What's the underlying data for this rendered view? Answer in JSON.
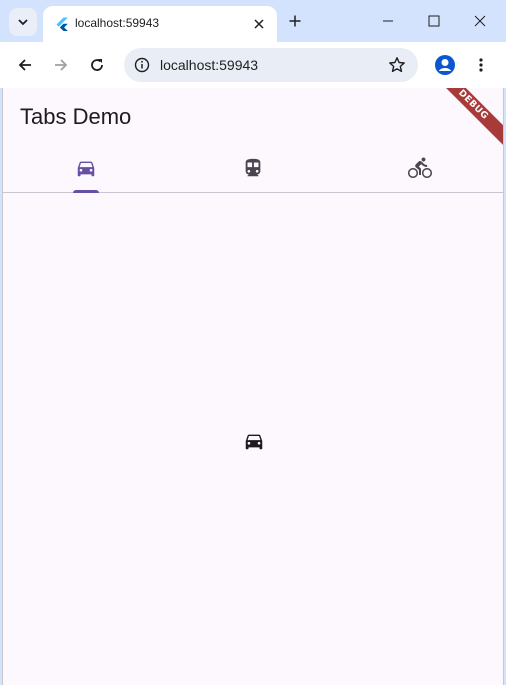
{
  "browser": {
    "tab_title": "localhost:59943",
    "url": "localhost:59943"
  },
  "app": {
    "title": "Tabs Demo",
    "tabs": [
      {
        "icon": "directions-car-icon",
        "selected": true
      },
      {
        "icon": "directions-transit-icon",
        "selected": false
      },
      {
        "icon": "directions-bike-icon",
        "selected": false
      }
    ],
    "content_icon": "directions-car-icon",
    "debug_banner": "DEBUG",
    "colors": {
      "accent": "#6750a4",
      "background": "#fdf7fe",
      "banner": "#a83a3a"
    }
  }
}
